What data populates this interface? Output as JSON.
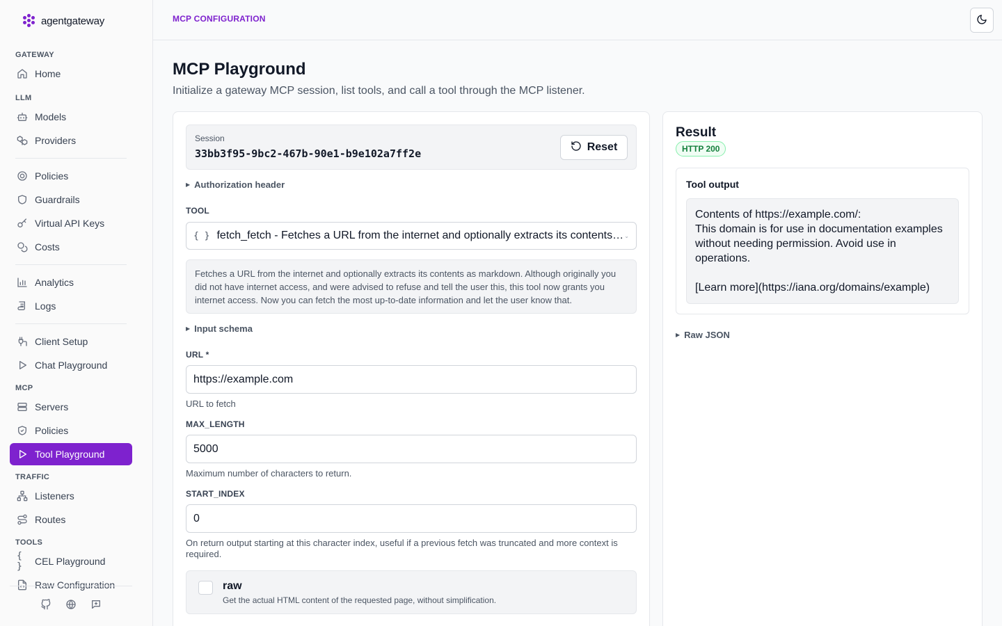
{
  "brand": {
    "name": "agentgateway"
  },
  "sidebar": {
    "sections": {
      "gateway": "GATEWAY",
      "llm": "LLM",
      "mcp": "MCP",
      "traffic": "TRAFFIC",
      "tools": "TOOLS"
    },
    "items": {
      "home": "Home",
      "models": "Models",
      "providers": "Providers",
      "policies": "Policies",
      "guardrails": "Guardrails",
      "virtual_api_keys": "Virtual API Keys",
      "costs": "Costs",
      "analytics": "Analytics",
      "logs": "Logs",
      "client_setup": "Client Setup",
      "chat_playground": "Chat Playground",
      "servers": "Servers",
      "mcp_policies": "Policies",
      "tool_playground": "Tool Playground",
      "listeners": "Listeners",
      "routes": "Routes",
      "cel_playground": "CEL Playground",
      "raw_configuration": "Raw Configuration"
    }
  },
  "header": {
    "section": "MCP CONFIGURATION",
    "title": "MCP Playground",
    "subtitle": "Initialize a gateway MCP session, list tools, and call a tool through the MCP listener."
  },
  "session": {
    "label": "Session",
    "id": "33bb3f95-9bc2-467b-90e1-b9e102a7ff2e",
    "reset_label": "Reset"
  },
  "form": {
    "auth_header": "Authorization header",
    "tool_label": "TOOL",
    "tool_value": "fetch_fetch - Fetches a URL from the internet and optionally extracts its contents as markdown.",
    "tool_description": "Fetches a URL from the internet and optionally extracts its contents as markdown. Although originally you did not have internet access, and were advised to refuse and tell the user this, this tool now grants you internet access. Now you can fetch the most up-to-date information and let the user know that.",
    "input_schema": "Input schema",
    "url_label": "URL *",
    "url_value": "https://example.com",
    "url_help": "URL to fetch",
    "max_length_label": "MAX_LENGTH",
    "max_length_value": "5000",
    "max_length_help": "Maximum number of characters to return.",
    "start_index_label": "START_INDEX",
    "start_index_value": "0",
    "start_index_help": "On return output starting at this character index, useful if a previous fetch was truncated and more context is required.",
    "raw_label": "raw",
    "raw_help": "Get the actual HTML content of the requested page, without simplification."
  },
  "result": {
    "title": "Result",
    "status": "HTTP 200",
    "output_title": "Tool output",
    "output_text": "Contents of https://example.com/:\nThis domain is for use in documentation examples without needing permission. Avoid use in operations.\n\n[Learn more](https://iana.org/domains/example)",
    "raw_json": "Raw JSON"
  },
  "colors": {
    "accent": "#7e22ce",
    "success": "#15803d"
  }
}
